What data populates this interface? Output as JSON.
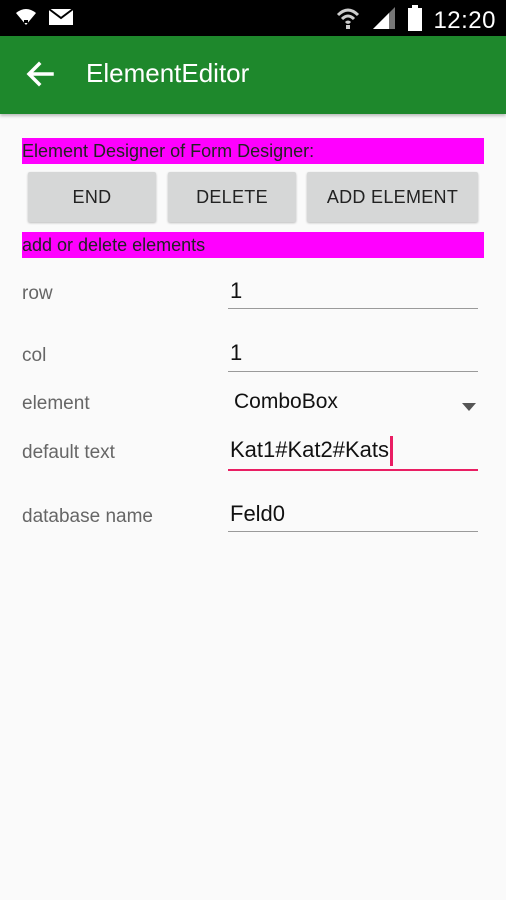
{
  "status_bar": {
    "time": "12:20",
    "icons": [
      "wifi-icon",
      "mail-icon",
      "wifi-signal-icon",
      "cell-signal-icon",
      "battery-icon"
    ]
  },
  "app_bar": {
    "title": "ElementEditor",
    "back_icon": "arrow-back-icon",
    "color": "#1e882c"
  },
  "header_banner": "Element Designer of Form Designer:",
  "buttons": {
    "end": "END",
    "delete": "DELETE",
    "add_element": "ADD ELEMENT"
  },
  "sub_banner": "add or delete elements",
  "banner_color": "#ff00ff",
  "form": {
    "row": {
      "label": "row",
      "value": "1"
    },
    "col": {
      "label": "col",
      "value": "1"
    },
    "element": {
      "label": "element",
      "value": "ComboBox"
    },
    "default_text": {
      "label": "default text",
      "value": "Kat1#Kat2#Kats"
    },
    "database_name": {
      "label": "database name",
      "value": "Feld0"
    }
  },
  "accent_color": "#e91e63"
}
